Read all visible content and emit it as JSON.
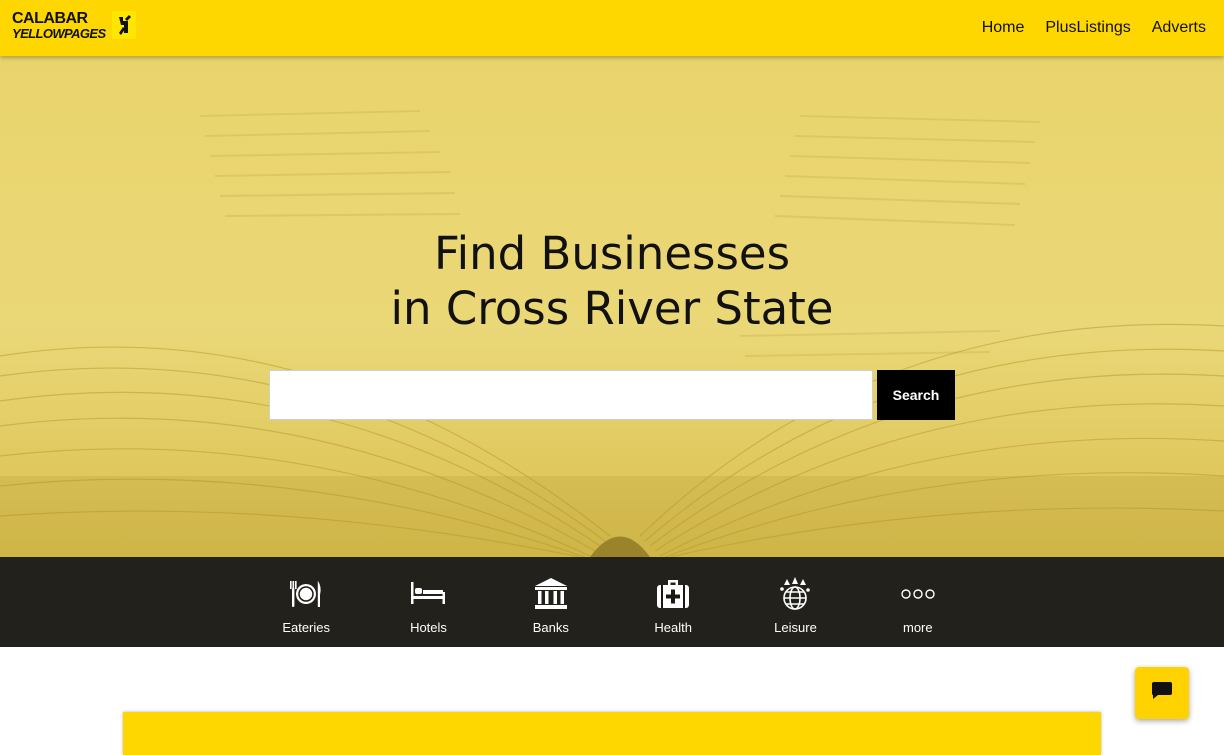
{
  "brand": {
    "line1": "CALABAR",
    "line2": "YELLOWPAGES",
    "accent_color": "#ffd700"
  },
  "nav": {
    "items": [
      {
        "label": "Home"
      },
      {
        "label": "PlusListings"
      },
      {
        "label": "Adverts"
      }
    ]
  },
  "hero": {
    "headline_line1": "Find Businesses",
    "headline_line2": "in Cross River State"
  },
  "search": {
    "value": "",
    "placeholder": "",
    "button_label": "Search"
  },
  "categories": [
    {
      "label": "Eateries",
      "icon": "plate-cutlery-icon"
    },
    {
      "label": "Hotels",
      "icon": "bed-icon"
    },
    {
      "label": "Banks",
      "icon": "bank-icon"
    },
    {
      "label": "Health",
      "icon": "medical-kit-icon"
    },
    {
      "label": "Leisure",
      "icon": "leisure-globe-icon"
    },
    {
      "label": "more",
      "icon": "more-dots-icon"
    }
  ],
  "chat": {
    "icon": "chat-bubble-icon"
  }
}
